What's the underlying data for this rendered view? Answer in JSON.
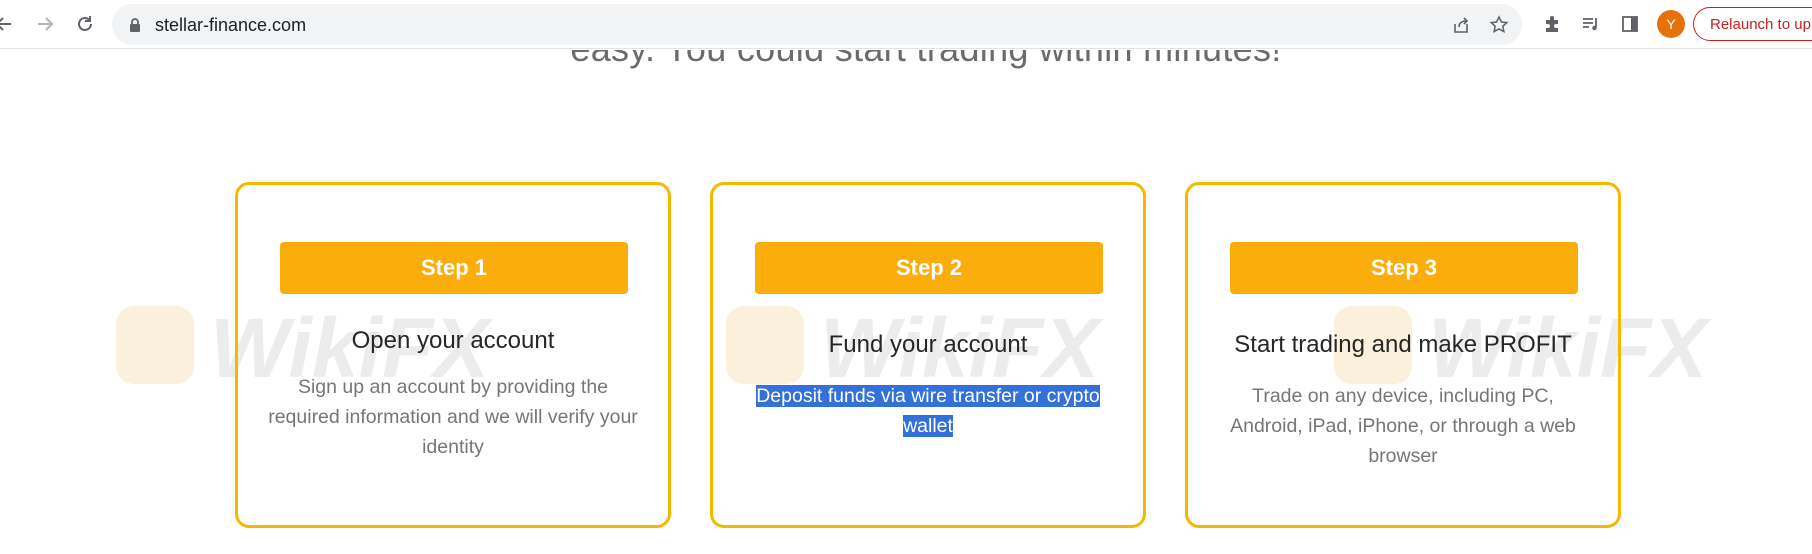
{
  "browser": {
    "url": "stellar-finance.com",
    "avatar_letter": "Y",
    "relaunch_label": "Relaunch to up"
  },
  "page": {
    "headline": "easy. You could start trading within minutes!",
    "watermark": "WikiFX",
    "steps": [
      {
        "button": "Step 1",
        "title": "Open your account",
        "description": "Sign up an account by providing the required information and we will verify your identity"
      },
      {
        "button": "Step 2",
        "title": "Fund your account",
        "description_line1": "Deposit funds via wire transfer or crypto",
        "description_line2": "wallet"
      },
      {
        "button": "Step 3",
        "title": "Start trading and make PROFIT",
        "description": "Trade on any device, including PC, Android, iPad, iPhone, or through a web browser"
      }
    ]
  },
  "colors": {
    "accent": "#fbad0b",
    "card_border": "#f5b800",
    "selection": "#3370d7",
    "relaunch": "#c5221f"
  }
}
